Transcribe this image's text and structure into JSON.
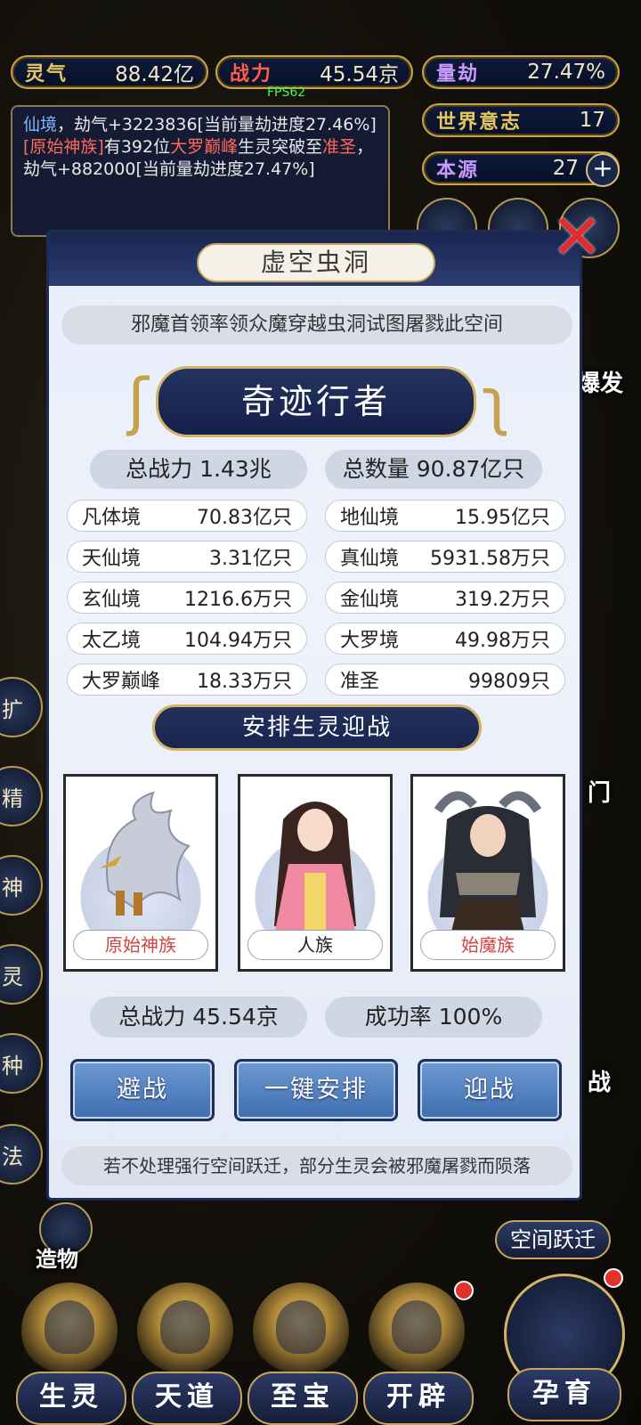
{
  "hud": {
    "lingqi": {
      "label": "灵气",
      "value": "88.42亿"
    },
    "zhanli": {
      "label": "战力",
      "value": "45.54京"
    },
    "liangjie": {
      "label": "量劫",
      "value": "27.47%"
    },
    "world_will": {
      "label": "世界意志",
      "value": "17"
    },
    "benyuan": {
      "label": "本源",
      "value": "27"
    },
    "fps": "FPS62"
  },
  "log": {
    "line1_highlight": "仙境",
    "line1_rest": "，劫气+3223836[当前量劫进度27.46%]",
    "line2_bracket": "[原始神族]",
    "line2_mid": "有392位",
    "line2_rank": "大罗巅峰",
    "line2_mid2": "生灵突破至",
    "line2_rank2": "准圣",
    "line2_rest": "，劫气+882000[当前量劫进度27.47%]"
  },
  "side": {
    "right_baofa": "爆发",
    "right_men": "门",
    "right_zhan": "战",
    "space_jump": "空间跃迁",
    "zaowu": "造物",
    "left_chars": [
      "扩",
      "精",
      "神",
      "灵",
      "种",
      "法"
    ]
  },
  "nav": [
    {
      "label": "生灵"
    },
    {
      "label": "天道"
    },
    {
      "label": "至宝"
    },
    {
      "label": "开辟"
    },
    {
      "label": "孕育"
    }
  ],
  "modal": {
    "title": "虚空虫洞",
    "description": "邪魔首领率领众魔穿越虫洞试图屠戮此空间",
    "enemy_name": "奇迹行者",
    "total_power_label": "总战力",
    "total_power": "1.43兆",
    "total_count_label": "总数量",
    "total_count": "90.87亿只",
    "realms": [
      {
        "name": "凡体境",
        "count": "70.83亿只"
      },
      {
        "name": "地仙境",
        "count": "15.95亿只"
      },
      {
        "name": "天仙境",
        "count": "3.31亿只"
      },
      {
        "name": "真仙境",
        "count": "5931.58万只"
      },
      {
        "name": "玄仙境",
        "count": "1216.6万只"
      },
      {
        "name": "金仙境",
        "count": "319.2万只"
      },
      {
        "name": "太乙境",
        "count": "104.94万只"
      },
      {
        "name": "大罗境",
        "count": "49.98万只"
      },
      {
        "name": "大罗巅峰",
        "count": "18.33万只"
      },
      {
        "name": "准圣",
        "count": "99809只"
      }
    ],
    "arrange_title": "安排生灵迎战",
    "races": [
      {
        "name": "原始神族"
      },
      {
        "name": "人族"
      },
      {
        "name": "始魔族"
      }
    ],
    "our_power_label": "总战力",
    "our_power": "45.54京",
    "success_label": "成功率",
    "success_rate": "100%",
    "buttons": {
      "avoid": "避战",
      "auto": "一键安排",
      "fight": "迎战"
    },
    "warning": "若不处理强行空间跃迁，部分生灵会被邪魔屠戮而陨落",
    "close_icon": "close-x-icon"
  },
  "colors": {
    "gold": "#c9a54a",
    "navy": "#1f2b55",
    "red": "#e32b2b",
    "button_blue": "#4f7fc0"
  }
}
